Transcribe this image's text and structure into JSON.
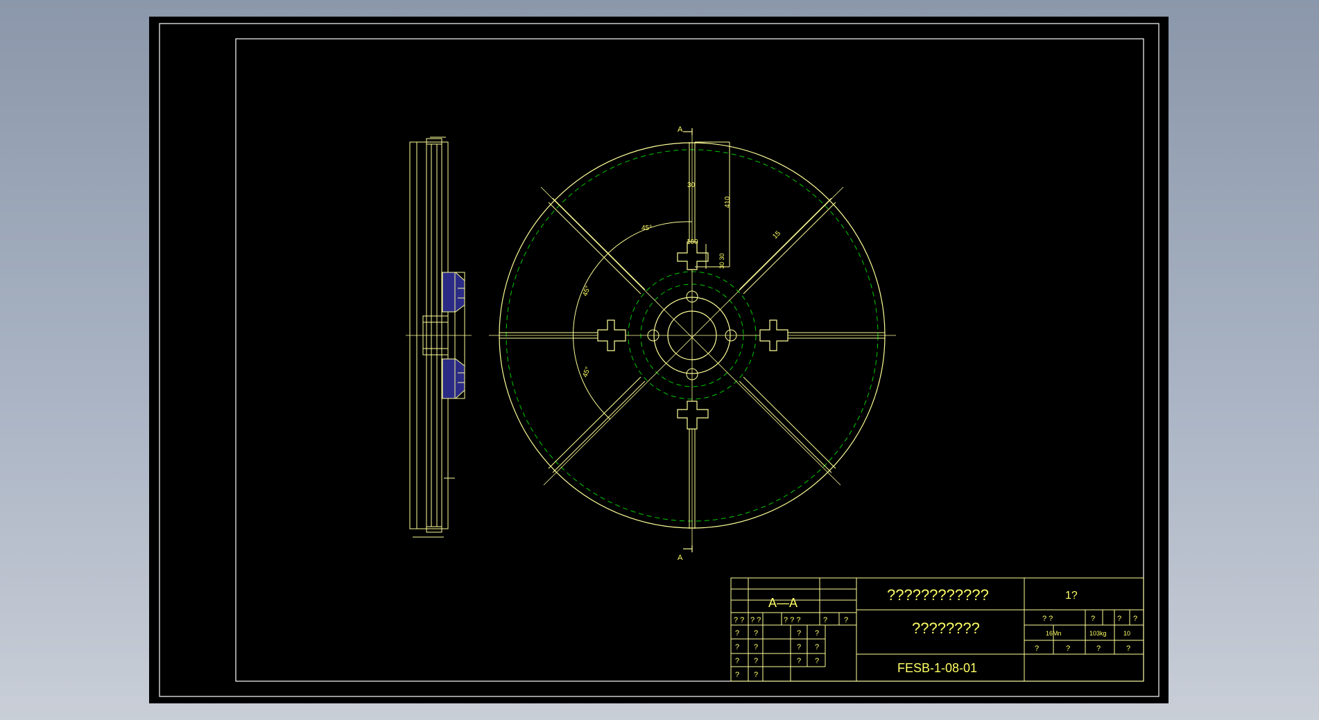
{
  "colors": {
    "background_top": "#8b97aa",
    "background_bottom": "#c9ced7",
    "sheet": "#000000",
    "border": "#ffffff",
    "geometry": "#ffff99",
    "centerline": "#00cc00",
    "text": "#ffff66",
    "hatch": "#2b2b86"
  },
  "drawing": {
    "section_mark_top": "A",
    "section_mark_bottom": "A",
    "dimensions": {
      "radial_30": "30",
      "radial_410": "410",
      "angle_top": "45°",
      "angle_left_upper": "45°",
      "angle_left_lower": "45°",
      "width_100": "100",
      "slot_30_30": "30 30",
      "rib_15": "15"
    }
  },
  "title_block": {
    "section_label": "A—A",
    "company_name": "????????????",
    "sheet_label": "1?",
    "part_name": "????????",
    "drawing_number": "FESB-1-08-01",
    "header_row": [
      "? ?",
      "? ?",
      "? ? ?",
      "?",
      "?"
    ],
    "left_rows": [
      [
        "?",
        "?",
        "?",
        "?"
      ],
      [
        "?",
        "?",
        "?",
        "?"
      ],
      [
        "?",
        "?",
        "?",
        "?"
      ],
      [
        "?",
        "?",
        "",
        ""
      ]
    ],
    "props_header": [
      "? ?",
      "?",
      "?",
      "?"
    ],
    "material": "16Mn",
    "weight": "103kg",
    "scale": "10",
    "props_footer": [
      "?",
      "?",
      "?",
      "?"
    ]
  }
}
